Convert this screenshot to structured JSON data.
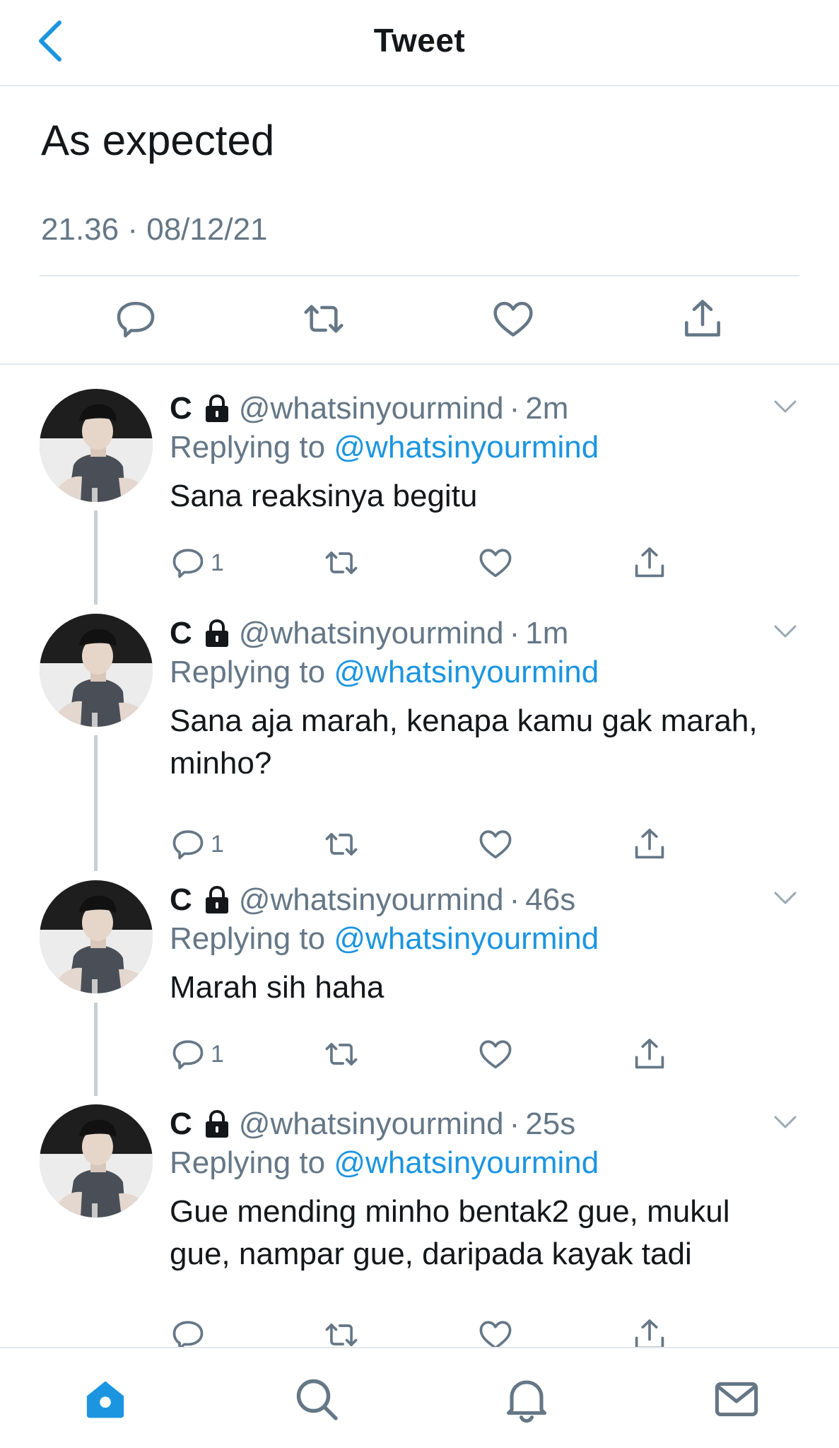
{
  "header": {
    "title": "Tweet"
  },
  "main_tweet": {
    "text": "As expected",
    "time": "21.36",
    "separator": "·",
    "date": "08/12/21"
  },
  "colors": {
    "accent": "#1b95e0",
    "muted": "#657786",
    "divider": "#e1e8ed",
    "icon": "#657786"
  },
  "icons": {
    "back": "chevron-left-icon",
    "reply": "reply-bubble-icon",
    "retweet": "retweet-icon",
    "like": "heart-icon",
    "share": "share-icon",
    "lock": "lock-icon",
    "menu": "chevron-down-icon"
  },
  "replies": [
    {
      "name": "C",
      "handle": "@whatsinyourmind",
      "time": "2m",
      "replying_label": "Replying to",
      "mention": "@whatsinyourmind",
      "text": "Sana reaksinya begitu",
      "reply_count": "1"
    },
    {
      "name": "C",
      "handle": "@whatsinyourmind",
      "time": "1m",
      "replying_label": "Replying to",
      "mention": "@whatsinyourmind",
      "text": "Sana aja marah, kenapa kamu gak marah, minho?",
      "reply_count": "1"
    },
    {
      "name": "C",
      "handle": "@whatsinyourmind",
      "time": "46s",
      "replying_label": "Replying to",
      "mention": "@whatsinyourmind",
      "text": "Marah sih haha",
      "reply_count": "1"
    },
    {
      "name": "C",
      "handle": "@whatsinyourmind",
      "time": "25s",
      "replying_label": "Replying to",
      "mention": "@whatsinyourmind",
      "text": "Gue mending minho bentak2 gue, mukul gue, nampar gue, daripada kayak tadi",
      "reply_count": ""
    }
  ],
  "tabbar": {
    "items": [
      "home-icon",
      "search-icon",
      "notifications-icon",
      "messages-icon"
    ],
    "active": "home-icon"
  }
}
